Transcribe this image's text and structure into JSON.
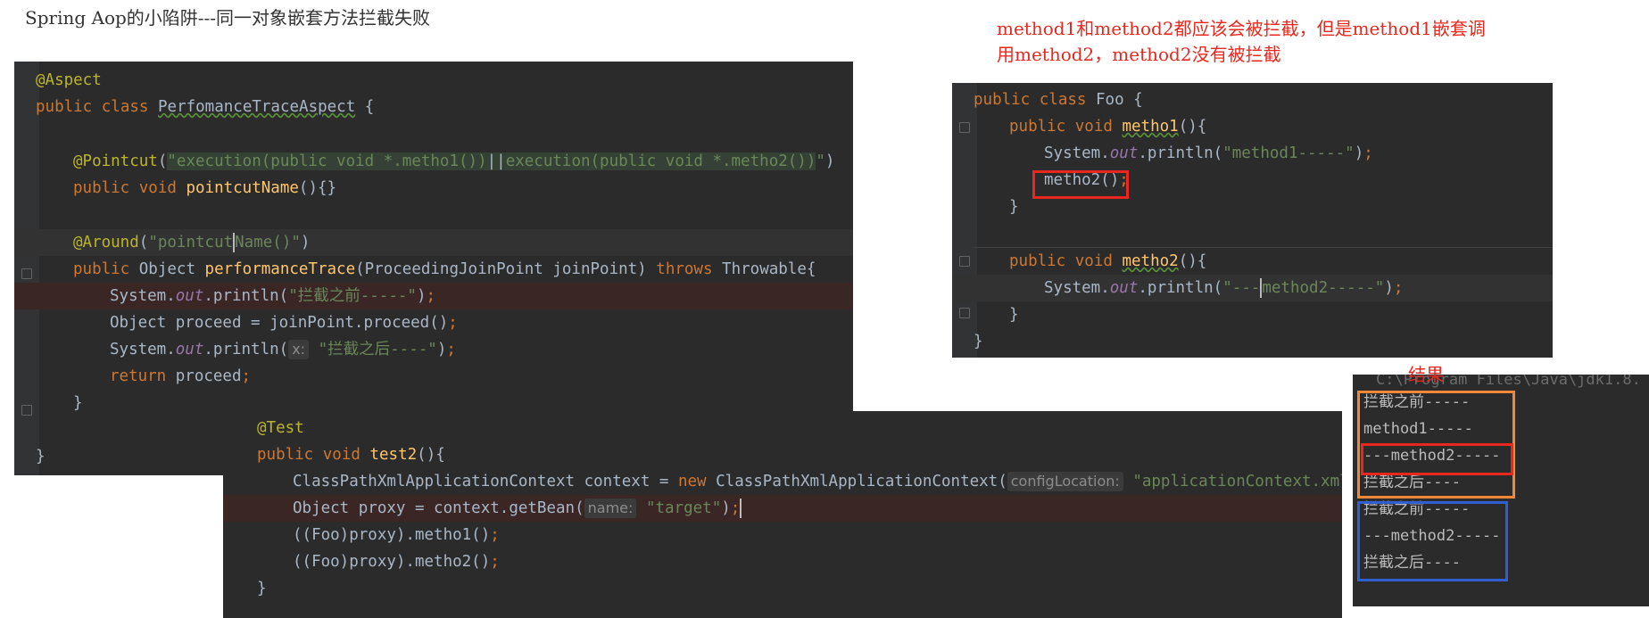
{
  "page_title": "Spring Aop的小陷阱---同一对象嵌套方法拦截失败",
  "note": {
    "line1": "method1和method2都应该会被拦截，但是method1嵌套调",
    "line2": "用method2，method2没有被拦截"
  },
  "result_label": "结果",
  "aspect_code": {
    "annotation_aspect": "@Aspect",
    "kw_public": "public",
    "kw_class": "class",
    "class_name": "PerfomanceTraceAspect",
    "brace_open": " {",
    "pointcut_annotation": "@Pointcut",
    "pointcut_expr_1": "execution(public void *.metho1())",
    "pointcut_or": "||",
    "pointcut_expr_2": "execution(public void *.metho2())",
    "kw_void": "void",
    "pointcut_method": "pointcutName",
    "pointcut_body": "(){}",
    "around_annotation": "@Around",
    "around_arg_a": "\"pointcut",
    "around_arg_b": "Name()\"",
    "return_type": "Object",
    "advice_method": "performanceTrace",
    "advice_params": "(ProceedingJoinPoint joinPoint)",
    "kw_throws": "throws",
    "throwable": "Throwable{",
    "sys": "System.",
    "out": "out",
    "println": ".println(",
    "str_before": "\"拦截之前-----\"",
    "proceed_decl": "Object proceed = joinPoint.proceed()",
    "hint_x": "x:",
    "str_after": "\"拦截之后----\"",
    "kw_return": "return",
    "return_val": " proceed",
    "brace_close": "}"
  },
  "foo_code": {
    "kw_public": "public",
    "kw_class": "class",
    "class_name": "Foo {",
    "kw_void": "void",
    "method1": "metho1",
    "method2": "metho2",
    "parens_brace": "(){",
    "sys": "System.",
    "out": "out",
    "println": ".println(",
    "str_m1": "\"method1-----\"",
    "call_m2": "metho2()",
    "str_m2_a": "\"---",
    "str_m2_b": "method2-----\"",
    "brace_close": "}"
  },
  "test_code": {
    "annotation_test": "@Test",
    "kw_public": "public",
    "kw_void": "void",
    "test_method": "test2",
    "parens_brace": "(){",
    "ctx_decl": "ClassPathXmlApplicationContext context = ",
    "kw_new": "new",
    "ctx_ctor": " ClassPathXmlApplicationContext(",
    "hint_config": "configLocation:",
    "str_xml": "\"applicationContext.xml\"",
    "proxy_decl": "Object proxy = context.getBean(",
    "hint_name": "name:",
    "str_target": "\"target\"",
    "call1": "((Foo)proxy).metho1()",
    "call2": "((Foo)proxy).metho2()",
    "brace_close": "}"
  },
  "console": {
    "header": "C:\\Program Files\\Java\\jdk1.8.",
    "lines": [
      "拦截之前-----",
      "method1-----",
      "---method2-----",
      "拦截之后----",
      "拦截之前-----",
      "---method2-----",
      "拦截之后----"
    ]
  },
  "colors": {
    "highlight_red": "#e8281e",
    "highlight_orange": "#f0883a",
    "highlight_blue": "#2f5fd0",
    "editor_bg": "#2b2b2b"
  }
}
